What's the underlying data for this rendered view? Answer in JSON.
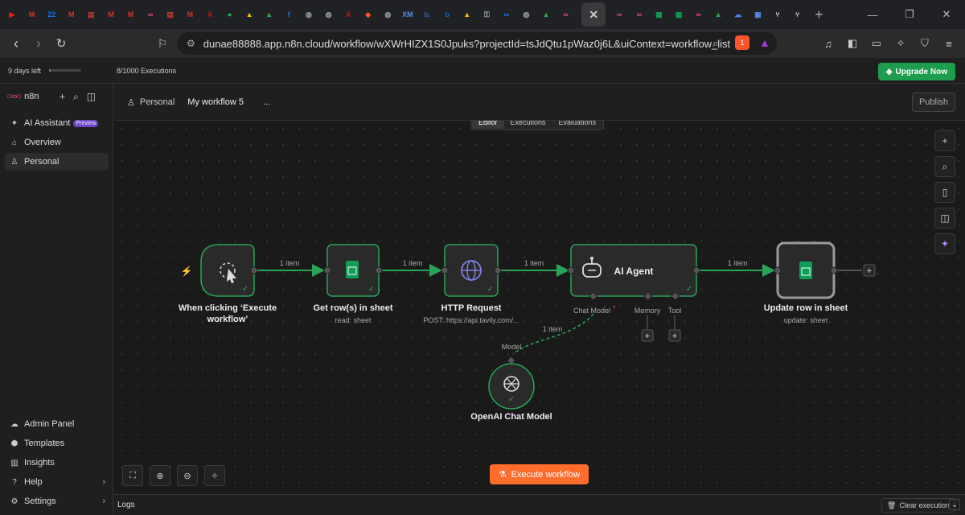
{
  "browser": {
    "tabs": [
      {
        "icon": "youtube-icon",
        "glyph": "▶",
        "color": "#e62117"
      },
      {
        "icon": "gmail-icon",
        "glyph": "M",
        "color": "#d93025"
      },
      {
        "icon": "calendar-icon",
        "glyph": "22",
        "color": "#1a73e8"
      },
      {
        "icon": "gmail-icon",
        "glyph": "M",
        "color": "#d93025"
      },
      {
        "icon": "pdf-icon",
        "glyph": "▤",
        "color": "#c0392b"
      },
      {
        "icon": "gmail-icon",
        "glyph": "M",
        "color": "#d93025"
      },
      {
        "icon": "gmail-icon",
        "glyph": "M",
        "color": "#d93025"
      },
      {
        "icon": "n8n-icon",
        "glyph": "∞",
        "color": "#ea4b71"
      },
      {
        "icon": "pdf-icon",
        "glyph": "▤",
        "color": "#c0392b"
      },
      {
        "icon": "gmail-icon",
        "glyph": "M",
        "color": "#d93025"
      },
      {
        "icon": "a-icon",
        "glyph": "A",
        "color": "#b71c1c"
      },
      {
        "icon": "spotify-icon",
        "glyph": "●",
        "color": "#1db954"
      },
      {
        "icon": "drive-icon",
        "glyph": "▲",
        "color": "#fbbc04"
      },
      {
        "icon": "drive-icon",
        "glyph": "▲",
        "color": "#34a853"
      },
      {
        "icon": "facebook-icon",
        "glyph": "f",
        "color": "#1877f2"
      },
      {
        "icon": "globe-icon",
        "glyph": "◍",
        "color": "#9aa0a6"
      },
      {
        "icon": "globe-icon",
        "glyph": "◍",
        "color": "#9aa0a6"
      },
      {
        "icon": "a-icon",
        "glyph": "A",
        "color": "#b71c1c"
      },
      {
        "icon": "brave-icon",
        "glyph": "◆",
        "color": "#fb542b"
      },
      {
        "icon": "globe-icon",
        "glyph": "◍",
        "color": "#9aa0a6"
      },
      {
        "icon": "xm-icon",
        "glyph": "XM",
        "color": "#5b8def"
      },
      {
        "icon": "b-icon",
        "glyph": "b.",
        "color": "#1e63c7"
      },
      {
        "icon": "b-icon",
        "glyph": "b",
        "color": "#1e63c7"
      },
      {
        "icon": "drive-icon",
        "glyph": "▲",
        "color": "#fbbc04"
      },
      {
        "icon": "key-icon",
        "glyph": "⚿",
        "color": "#9aa0a6"
      },
      {
        "icon": "meta-icon",
        "glyph": "∞",
        "color": "#1877f2"
      },
      {
        "icon": "globe-icon",
        "glyph": "◍",
        "color": "#9aa0a6"
      },
      {
        "icon": "drive-icon",
        "glyph": "▲",
        "color": "#34a853"
      },
      {
        "icon": "n8n-icon",
        "glyph": "∞",
        "color": "#ea4b71"
      }
    ],
    "tabs_after": [
      {
        "icon": "n8n-icon",
        "glyph": "∞",
        "color": "#ea4b71"
      },
      {
        "icon": "n8n-icon",
        "glyph": "∞",
        "color": "#ea4b71"
      },
      {
        "icon": "sheets-icon",
        "glyph": "▦",
        "color": "#0f9d58"
      },
      {
        "icon": "sheets-icon",
        "glyph": "▦",
        "color": "#0f9d58"
      },
      {
        "icon": "n8n-icon",
        "glyph": "∞",
        "color": "#ea4b71"
      },
      {
        "icon": "drive-icon",
        "glyph": "▲",
        "color": "#34a853"
      },
      {
        "icon": "cloud-icon",
        "glyph": "☁",
        "color": "#4285f4"
      },
      {
        "icon": "app-icon",
        "glyph": "▣",
        "color": "#5b8def"
      },
      {
        "icon": "n8n-icon",
        "glyph": "⑂",
        "color": "#dddddd"
      },
      {
        "icon": "n8n-icon",
        "glyph": "⑂",
        "color": "#dddddd"
      }
    ],
    "url": "dunae88888.app.n8n.cloud/workflow/wXWrHIZX1S0Jpuks?projectId=tsJdQtu1pWaz0j6L&uiContext=workflow_list",
    "brave_count": "1"
  },
  "plan": {
    "days_left": "9 days left",
    "executions": "8/1000 Executions",
    "executions_used_fraction": 0.008,
    "upgrade_label": "Upgrade Now"
  },
  "sidebar": {
    "brand": "n8n",
    "items": [
      {
        "label": "AI Assistant",
        "badge": "Preview"
      },
      {
        "label": "Overview"
      },
      {
        "label": "Personal"
      }
    ],
    "bottom_items": [
      {
        "label": "Admin Panel"
      },
      {
        "label": "Templates"
      },
      {
        "label": "Insights"
      },
      {
        "label": "Help"
      },
      {
        "label": "Settings"
      }
    ]
  },
  "header": {
    "project": "Personal",
    "workflow_name": "My workflow 5",
    "more": "...",
    "publish_label": "Publish"
  },
  "mode_tabs": [
    "Editor",
    "Executions",
    "Evaluations"
  ],
  "canvas": {
    "nodes": [
      {
        "name": "When clicking ‘Execute",
        "name2": "workflow’",
        "subtitle": ""
      },
      {
        "name": "Get row(s) in sheet",
        "subtitle": "read: sheet"
      },
      {
        "name": "HTTP Request",
        "subtitle": "POST: https://api.tavily.com/..."
      },
      {
        "name": "AI Agent",
        "subtitle": ""
      },
      {
        "name": "Update row in sheet",
        "subtitle": "update: sheet"
      },
      {
        "name": "OpenAI Chat Model",
        "subtitle": ""
      }
    ],
    "edge_labels": [
      "1 item",
      "1 item",
      "1 item",
      "1 item",
      "1 item"
    ],
    "agent_ports": {
      "chat_model": "Chat Model",
      "required": "*",
      "memory": "Memory",
      "tool": "Tool",
      "model": "Model"
    },
    "execute_label": "Execute workflow"
  },
  "logs": {
    "label": "Logs",
    "clear_label": "Clear execution"
  },
  "colors": {
    "success": "#29a356",
    "accent": "#ff6d2d",
    "upgrade": "#1f9d4e",
    "sheets": "#0f9d58",
    "http": "#7e7fe0"
  }
}
